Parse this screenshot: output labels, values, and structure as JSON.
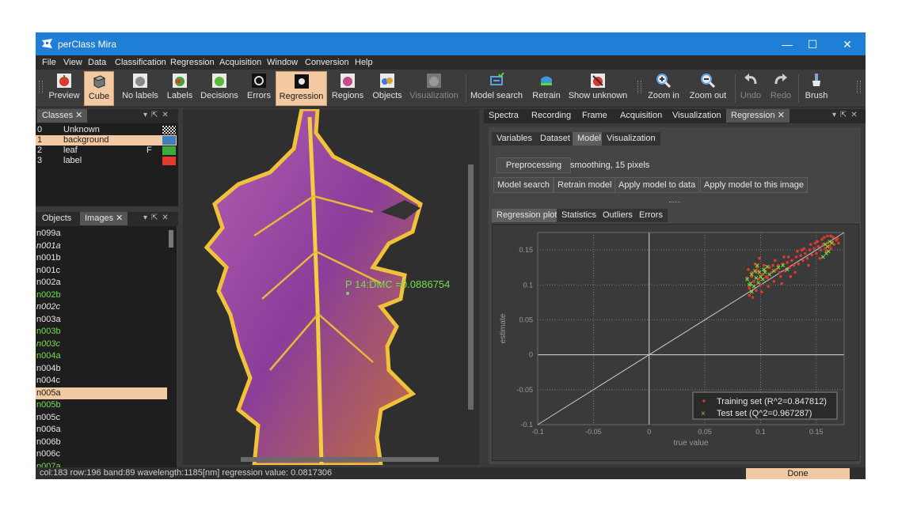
{
  "window": {
    "title": "perClass Mira",
    "controls": [
      "—",
      "☐",
      "✕"
    ]
  },
  "menu": [
    "File",
    "View",
    "Data",
    "Classification",
    "Regression",
    "Acquisition",
    "Window",
    "Conversion",
    "Help"
  ],
  "toolbar": {
    "preview": "Preview",
    "cube": "Cube",
    "no_labels": "No labels",
    "labels": "Labels",
    "decisions": "Decisions",
    "errors": "Errors",
    "regression": "Regression",
    "regions": "Regions",
    "objects": "Objects",
    "visualization": "Visualization",
    "model_search": "Model search",
    "retrain": "Retrain",
    "show_unknown": "Show unknown",
    "zoom_in": "Zoom in",
    "zoom_out": "Zoom out",
    "undo": "Undo",
    "redo": "Redo",
    "brush": "Brush"
  },
  "classes_panel": {
    "tab": "Classes",
    "rows": [
      {
        "num": "0",
        "name": "Unknown",
        "key": "",
        "color": "checker"
      },
      {
        "num": "1",
        "name": "background",
        "key": "",
        "color": "#3f7fbf"
      },
      {
        "num": "2",
        "name": "leaf",
        "key": "F",
        "color": "#3caa3c"
      },
      {
        "num": "3",
        "name": "label",
        "key": "",
        "color": "#e23a2e"
      }
    ]
  },
  "images_panel": {
    "tabs": [
      "Objects",
      "Images"
    ],
    "items": [
      {
        "name": "n099a",
        "style": "normal"
      },
      {
        "name": "n001a",
        "style": "italic"
      },
      {
        "name": "n001b",
        "style": "normal"
      },
      {
        "name": "n001c",
        "style": "normal"
      },
      {
        "name": "n002a",
        "style": "normal"
      },
      {
        "name": "n002b",
        "style": "green"
      },
      {
        "name": "n002c",
        "style": "italic"
      },
      {
        "name": "n003a",
        "style": "normal"
      },
      {
        "name": "n003b",
        "style": "green"
      },
      {
        "name": "n003c",
        "style": "green-italic"
      },
      {
        "name": "n004a",
        "style": "green"
      },
      {
        "name": "n004b",
        "style": "normal"
      },
      {
        "name": "n004c",
        "style": "normal"
      },
      {
        "name": "n005a",
        "style": "selected"
      },
      {
        "name": "n005b",
        "style": "green"
      },
      {
        "name": "n005c",
        "style": "normal"
      },
      {
        "name": "n006a",
        "style": "normal"
      },
      {
        "name": "n006b",
        "style": "normal"
      },
      {
        "name": "n006c",
        "style": "normal"
      },
      {
        "name": "n007a",
        "style": "green"
      }
    ]
  },
  "image_view": {
    "annotation": "P 14:DMC =0.0886754"
  },
  "right_panel": {
    "tabs": [
      "Spectra",
      "Recording",
      "Frame",
      "Acquisition",
      "Visualization",
      "Regression"
    ],
    "active_tab": "Regression",
    "subtabs": [
      "Variables",
      "Dataset",
      "Model",
      "Visualization"
    ],
    "active_subtab": "Model",
    "preprocessing_button": "Preprocessing",
    "preprocessing_value": "smoothing, 15 pixels",
    "buttons": [
      "Model search",
      "Retrain model",
      "Apply model to data",
      "Apply model to this image"
    ],
    "plot_tabs": [
      "Regression plot",
      "Statistics",
      "Outliers",
      "Errors"
    ],
    "active_plot_tab": "Regression plot"
  },
  "chart_data": {
    "type": "scatter",
    "xlabel": "true value",
    "ylabel": "estimate",
    "xlim": [
      -0.1,
      0.175
    ],
    "ylim": [
      -0.1,
      0.175
    ],
    "x_ticks": [
      -0.1,
      -0.05,
      0,
      0.05,
      0.1,
      0.15
    ],
    "x_tick_labels": [
      "-0.1",
      "-0.05",
      "0",
      "0.05",
      "0.1",
      "0.15"
    ],
    "y_ticks": [
      -0.1,
      -0.05,
      0,
      0.05,
      0.1,
      0.15
    ],
    "y_tick_labels": [
      "-0.1",
      "-0.05",
      "0",
      "0.05",
      "0.1",
      "0.15"
    ],
    "grid": true,
    "legend_position": "bottom-right",
    "identity_line": true,
    "series": [
      {
        "name": "Training set (R^2=0.847812)",
        "marker": "dot",
        "color": "#e03a2a",
        "points": [
          [
            0.088,
            0.11
          ],
          [
            0.09,
            0.095
          ],
          [
            0.092,
            0.112
          ],
          [
            0.094,
            0.105
          ],
          [
            0.096,
            0.118
          ],
          [
            0.098,
            0.108
          ],
          [
            0.1,
            0.1
          ],
          [
            0.102,
            0.115
          ],
          [
            0.104,
            0.12
          ],
          [
            0.106,
            0.11
          ],
          [
            0.108,
            0.125
          ],
          [
            0.11,
            0.118
          ],
          [
            0.112,
            0.105
          ],
          [
            0.114,
            0.122
          ],
          [
            0.116,
            0.128
          ],
          [
            0.118,
            0.112
          ],
          [
            0.12,
            0.13
          ],
          [
            0.122,
            0.12
          ],
          [
            0.124,
            0.132
          ],
          [
            0.126,
            0.125
          ],
          [
            0.128,
            0.135
          ],
          [
            0.13,
            0.128
          ],
          [
            0.132,
            0.14
          ],
          [
            0.134,
            0.13
          ],
          [
            0.136,
            0.142
          ],
          [
            0.138,
            0.135
          ],
          [
            0.14,
            0.145
          ],
          [
            0.142,
            0.138
          ],
          [
            0.144,
            0.15
          ],
          [
            0.146,
            0.143
          ],
          [
            0.148,
            0.152
          ],
          [
            0.15,
            0.145
          ],
          [
            0.152,
            0.155
          ],
          [
            0.154,
            0.15
          ],
          [
            0.156,
            0.158
          ],
          [
            0.158,
            0.152
          ],
          [
            0.16,
            0.16
          ],
          [
            0.162,
            0.156
          ],
          [
            0.164,
            0.162
          ],
          [
            0.166,
            0.158
          ],
          [
            0.168,
            0.164
          ],
          [
            0.17,
            0.16
          ],
          [
            0.16,
            0.17
          ],
          [
            0.155,
            0.165
          ],
          [
            0.165,
            0.168
          ],
          [
            0.09,
            0.085
          ],
          [
            0.093,
            0.082
          ],
          [
            0.097,
            0.125
          ],
          [
            0.101,
            0.09
          ],
          [
            0.107,
            0.098
          ],
          [
            0.113,
            0.135
          ],
          [
            0.119,
            0.102
          ],
          [
            0.125,
            0.14
          ],
          [
            0.131,
            0.118
          ],
          [
            0.137,
            0.15
          ],
          [
            0.143,
            0.128
          ],
          [
            0.149,
            0.16
          ],
          [
            0.153,
            0.138
          ],
          [
            0.159,
            0.148
          ],
          [
            0.163,
            0.152
          ],
          [
            0.095,
            0.13
          ],
          [
            0.099,
            0.138
          ],
          [
            0.103,
            0.128
          ],
          [
            0.089,
            0.122
          ],
          [
            0.091,
            0.1
          ],
          [
            0.105,
            0.112
          ],
          [
            0.111,
            0.128
          ],
          [
            0.117,
            0.118
          ],
          [
            0.121,
            0.14
          ],
          [
            0.127,
            0.112
          ],
          [
            0.133,
            0.148
          ],
          [
            0.139,
            0.152
          ],
          [
            0.145,
            0.158
          ],
          [
            0.151,
            0.162
          ],
          [
            0.157,
            0.168
          ],
          [
            0.163,
            0.17
          ],
          [
            0.169,
            0.166
          ],
          [
            0.096,
            0.092
          ],
          [
            0.098,
            0.12
          ],
          [
            0.092,
            0.118
          ]
        ]
      },
      {
        "name": "Test set (Q^2=0.967287)",
        "marker": "x",
        "color": "#7ad83c",
        "points": [
          [
            0.088,
            0.108
          ],
          [
            0.09,
            0.1
          ],
          [
            0.092,
            0.115
          ],
          [
            0.094,
            0.098
          ],
          [
            0.096,
            0.11
          ],
          [
            0.098,
            0.103
          ],
          [
            0.1,
            0.112
          ],
          [
            0.102,
            0.108
          ],
          [
            0.104,
            0.118
          ],
          [
            0.108,
            0.115
          ],
          [
            0.112,
            0.12
          ],
          [
            0.116,
            0.125
          ],
          [
            0.12,
            0.128
          ],
          [
            0.124,
            0.122
          ],
          [
            0.092,
            0.09
          ],
          [
            0.095,
            0.12
          ],
          [
            0.097,
            0.128
          ],
          [
            0.091,
            0.102
          ],
          [
            0.158,
            0.158
          ],
          [
            0.162,
            0.162
          ],
          [
            0.16,
            0.155
          ],
          [
            0.164,
            0.16
          ],
          [
            0.156,
            0.14
          ],
          [
            0.159,
            0.145
          ],
          [
            0.161,
            0.148
          ],
          [
            0.099,
            0.118
          ],
          [
            0.103,
            0.122
          ],
          [
            0.106,
            0.126
          ]
        ]
      }
    ]
  }
}
